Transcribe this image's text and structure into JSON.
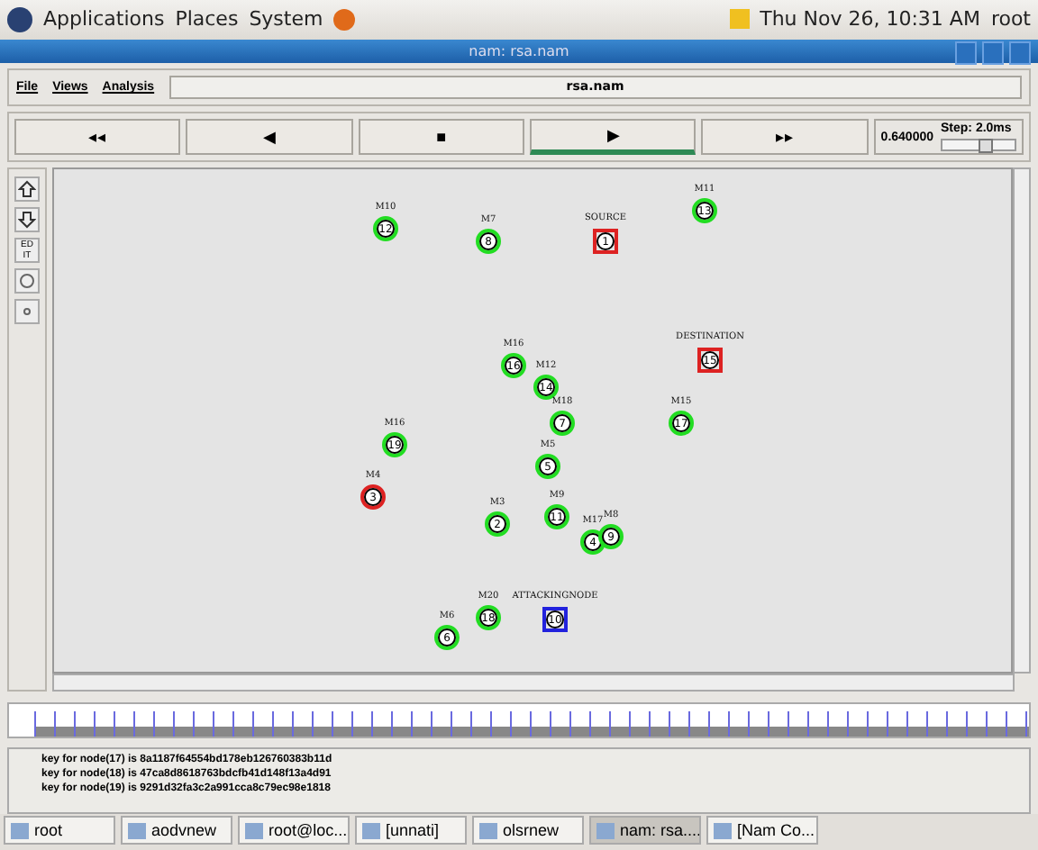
{
  "top_panel": {
    "menus": [
      "Applications",
      "Places",
      "System"
    ],
    "clock": "Thu Nov 26, 10:31 AM",
    "user": "root"
  },
  "window": {
    "title": "nam: rsa.nam"
  },
  "menu": [
    "File",
    "Views",
    "Analysis"
  ],
  "file_name": "rsa.nam",
  "controls": [
    {
      "symbol": "◂◂",
      "selected": false
    },
    {
      "symbol": "◀",
      "selected": false
    },
    {
      "symbol": "■",
      "selected": false
    },
    {
      "symbol": "▶",
      "selected": true
    },
    {
      "symbol": "▸▸",
      "selected": false
    }
  ],
  "time": "0.640000",
  "step": {
    "label": "Step: 2.0ms",
    "level": 0.6
  },
  "side_tools": [
    {
      "kind": "up"
    },
    {
      "kind": "down"
    },
    {
      "kind": "edit",
      "text": "ED IT"
    },
    {
      "kind": "circle"
    },
    {
      "kind": "dot"
    }
  ],
  "nodes": [
    {
      "label": "M10",
      "number": "12",
      "kind": "circle",
      "color": "#22dd22"
    },
    {
      "label": "M7",
      "number": "8",
      "kind": "circle",
      "color": "#22dd22"
    },
    {
      "label": "SOURCE",
      "number": "1",
      "kind": "square",
      "color": "#dd2222"
    },
    {
      "label": "M11",
      "number": "13",
      "kind": "circle",
      "color": "#22dd22"
    },
    {
      "label": "M16",
      "number": "16",
      "kind": "circle",
      "color": "#22dd22"
    },
    {
      "label": "M12",
      "number": "14",
      "kind": "circle",
      "color": "#22dd22"
    },
    {
      "label": "DESTINATION",
      "number": "15",
      "kind": "square",
      "color": "#dd2222"
    },
    {
      "label": "M18",
      "number": "7",
      "kind": "circle",
      "color": "#22dd22"
    },
    {
      "label": "M15",
      "number": "17",
      "kind": "circle",
      "color": "#22dd22"
    },
    {
      "label": "M16",
      "number": "19",
      "kind": "circle",
      "color": "#22dd22"
    },
    {
      "label": "M5",
      "number": "5",
      "kind": "circle",
      "color": "#22dd22"
    },
    {
      "label": "M4",
      "number": "3",
      "kind": "circle",
      "color": "#dd2222"
    },
    {
      "label": "M3",
      "number": "2",
      "kind": "circle",
      "color": "#22dd22"
    },
    {
      "label": "M9",
      "number": "11",
      "kind": "circle",
      "color": "#22dd22"
    },
    {
      "label": "M17",
      "number": "4",
      "kind": "circle",
      "color": "#22dd22"
    },
    {
      "label": "M8",
      "number": "9",
      "kind": "circle",
      "color": "#22dd22"
    },
    {
      "label": "M20",
      "number": "18",
      "kind": "circle",
      "color": "#22dd22"
    },
    {
      "label": "ATTACKINGNODE",
      "number": "10",
      "kind": "square",
      "color": "#2222dd"
    },
    {
      "label": "M6",
      "number": "6",
      "kind": "circle",
      "color": "#22dd22"
    }
  ],
  "log": [
    "key for node(17) is 8a1187f64554bd178eb126760383b11d",
    "key for node(18) is 47ca8d8618763bdcfb41d148f13a4d91",
    "key for node(19) is 9291d32fa3c2a991cca8c79ec98e1818"
  ],
  "taskbar": [
    {
      "label": "root",
      "selected": false
    },
    {
      "label": "aodvnew",
      "selected": false
    },
    {
      "label": "root@loc...",
      "selected": false
    },
    {
      "label": "[unnati]",
      "selected": false
    },
    {
      "label": "olsrnew",
      "selected": false
    },
    {
      "label": "nam: rsa....",
      "selected": true
    },
    {
      "label": "[Nam Co...",
      "selected": false
    }
  ]
}
